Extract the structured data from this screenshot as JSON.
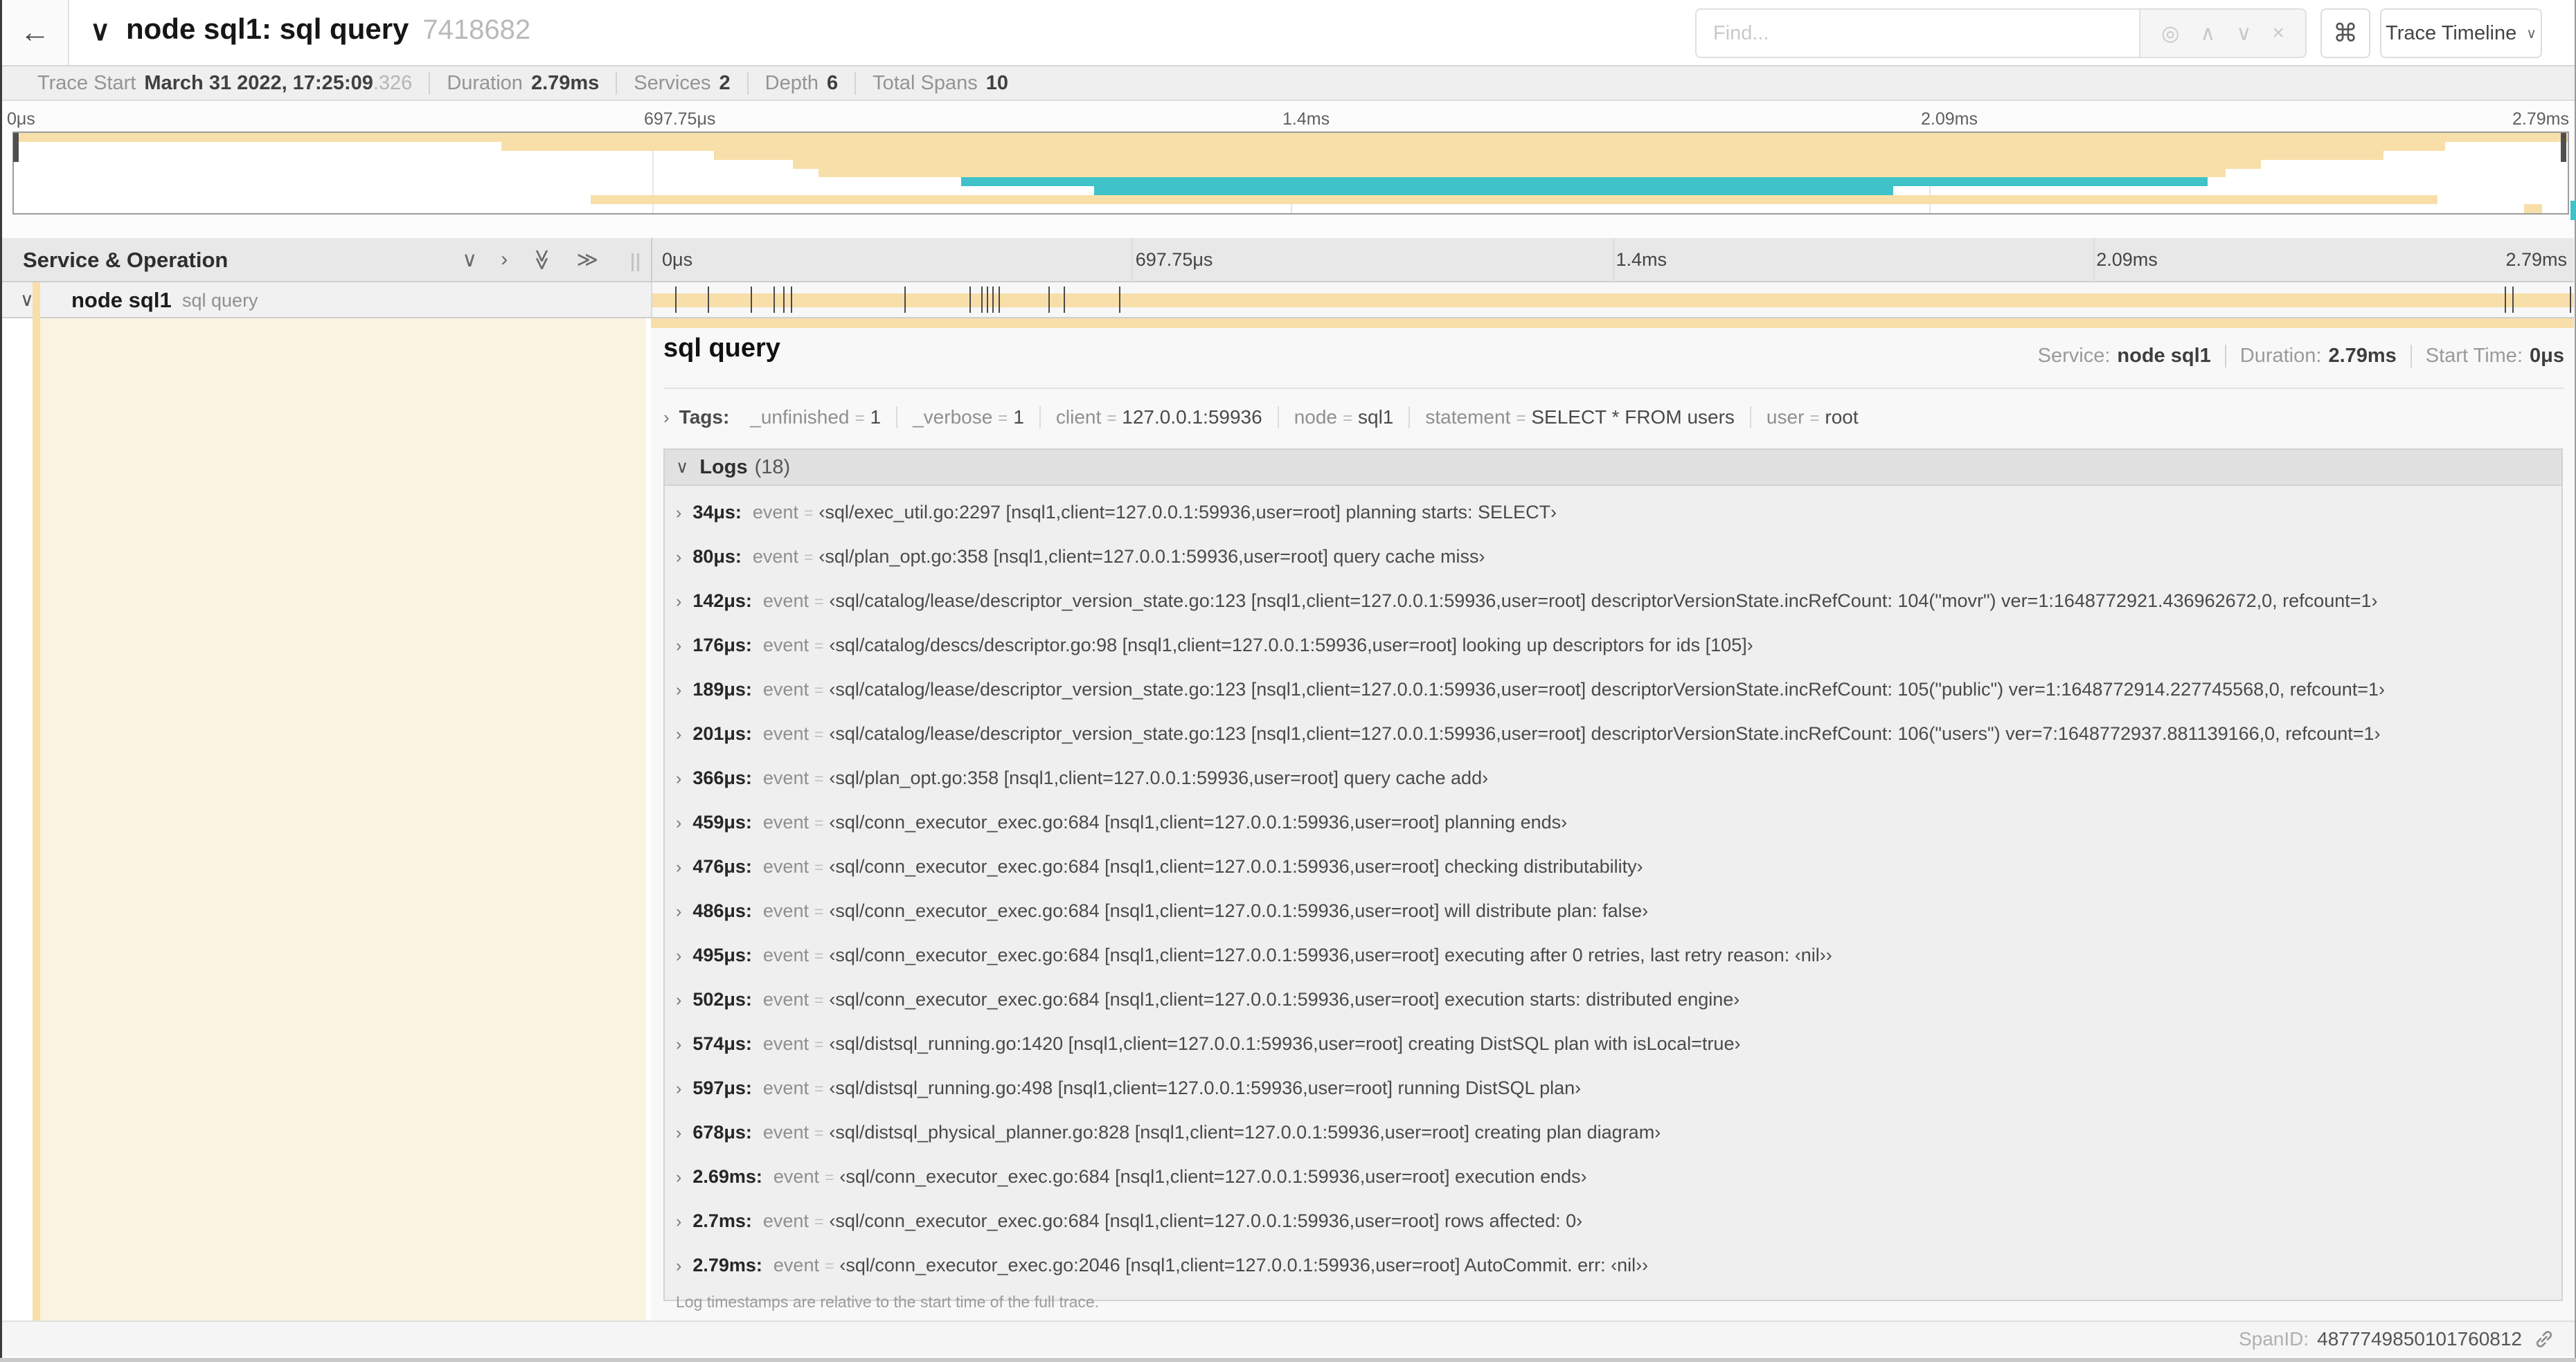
{
  "colors": {
    "span_tan": "#f8dfa9",
    "span_teal": "#3fc3c9",
    "detail_cream": "#faf3e1"
  },
  "icons": {
    "back": "←",
    "title_chevron": "∨",
    "locate": "◎",
    "prev": "∧",
    "next": "∨",
    "close": "×",
    "command": "⌘",
    "dropdown_chevron": "∨",
    "collapse_one": "∨",
    "expand_one": "›",
    "collapse_all": "≫",
    "expand_all": "≫",
    "row_chevron": "∨",
    "logs_chevron": "∨",
    "expander": "›"
  },
  "header": {
    "title": "node sql1: sql query",
    "trace_id": "7418682",
    "find_placeholder": "Find...",
    "view_selector": "Trace Timeline"
  },
  "summary": {
    "items": [
      {
        "label": "Trace Start",
        "value": "March 31 2022, 17:25:09",
        "suffix": ".326"
      },
      {
        "label": "Duration",
        "value": "2.79ms",
        "suffix": ""
      },
      {
        "label": "Services",
        "value": "2",
        "suffix": ""
      },
      {
        "label": "Depth",
        "value": "6",
        "suffix": ""
      },
      {
        "label": "Total Spans",
        "value": "10",
        "suffix": ""
      }
    ]
  },
  "time_ticks": [
    "0μs",
    "697.75μs",
    "1.4ms",
    "2.09ms",
    "2.79ms"
  ],
  "minimap": {
    "rows": 9,
    "spans": [
      {
        "start": 0.0,
        "end": 1.0,
        "color": "span_tan"
      },
      {
        "start": 0.191,
        "end": 0.952,
        "color": "span_tan"
      },
      {
        "start": 0.274,
        "end": 0.928,
        "color": "span_tan"
      },
      {
        "start": 0.305,
        "end": 0.88,
        "color": "span_tan"
      },
      {
        "start": 0.315,
        "end": 0.866,
        "color": "span_tan"
      },
      {
        "start": 0.371,
        "end": 0.859,
        "color": "span_teal"
      },
      {
        "start": 0.423,
        "end": 0.736,
        "color": "span_teal"
      },
      {
        "start": 0.226,
        "end": 0.949,
        "color": "span_tan"
      },
      {
        "start": 0.983,
        "end": 0.99,
        "color": "span_tan"
      }
    ]
  },
  "table": {
    "header_label": "Service & Operation"
  },
  "span_row": {
    "service": "node sql1",
    "operation": "sql query",
    "log_marker_fractions": [
      0.012,
      0.029,
      0.051,
      0.063,
      0.068,
      0.072,
      0.131,
      0.165,
      0.171,
      0.174,
      0.177,
      0.18,
      0.206,
      0.214,
      0.243,
      0.964,
      0.968,
      0.998
    ]
  },
  "detail": {
    "title": "sql query",
    "meta": [
      {
        "label": "Service:",
        "value": "node sql1"
      },
      {
        "label": "Duration:",
        "value": "2.79ms"
      },
      {
        "label": "Start Time:",
        "value": "0μs"
      }
    ],
    "tags_label": "Tags:",
    "eq": "=",
    "tags": [
      {
        "key": "_unfinished",
        "value": "1"
      },
      {
        "key": "_verbose",
        "value": "1"
      },
      {
        "key": "client",
        "value": "127.0.0.1:59936"
      },
      {
        "key": "node",
        "value": "sql1"
      },
      {
        "key": "statement",
        "value": "SELECT * FROM users"
      },
      {
        "key": "user",
        "value": "root"
      }
    ],
    "logs": {
      "label": "Logs",
      "count": "(18)",
      "key": "event",
      "rows": [
        {
          "time": "34μs:",
          "key": "event",
          "value": "‹sql/exec_util.go:2297 [nsql1,client=127.0.0.1:59936,user=root] planning starts: SELECT›"
        },
        {
          "time": "80μs:",
          "key": "event",
          "value": "‹sql/plan_opt.go:358 [nsql1,client=127.0.0.1:59936,user=root] query cache miss›"
        },
        {
          "time": "142μs:",
          "key": "event",
          "value": "‹sql/catalog/lease/descriptor_version_state.go:123 [nsql1,client=127.0.0.1:59936,user=root] descriptorVersionState.incRefCount: 104(\"movr\") ver=1:1648772921.436962672,0, refcount=1›"
        },
        {
          "time": "176μs:",
          "key": "event",
          "value": "‹sql/catalog/descs/descriptor.go:98 [nsql1,client=127.0.0.1:59936,user=root] looking up descriptors for ids [105]›"
        },
        {
          "time": "189μs:",
          "key": "event",
          "value": "‹sql/catalog/lease/descriptor_version_state.go:123 [nsql1,client=127.0.0.1:59936,user=root] descriptorVersionState.incRefCount: 105(\"public\") ver=1:1648772914.227745568,0, refcount=1›"
        },
        {
          "time": "201μs:",
          "key": "event",
          "value": "‹sql/catalog/lease/descriptor_version_state.go:123 [nsql1,client=127.0.0.1:59936,user=root] descriptorVersionState.incRefCount: 106(\"users\") ver=7:1648772937.881139166,0, refcount=1›"
        },
        {
          "time": "366μs:",
          "key": "event",
          "value": "‹sql/plan_opt.go:358 [nsql1,client=127.0.0.1:59936,user=root] query cache add›"
        },
        {
          "time": "459μs:",
          "key": "event",
          "value": "‹sql/conn_executor_exec.go:684 [nsql1,client=127.0.0.1:59936,user=root] planning ends›"
        },
        {
          "time": "476μs:",
          "key": "event",
          "value": "‹sql/conn_executor_exec.go:684 [nsql1,client=127.0.0.1:59936,user=root] checking distributability›"
        },
        {
          "time": "486μs:",
          "key": "event",
          "value": "‹sql/conn_executor_exec.go:684 [nsql1,client=127.0.0.1:59936,user=root] will distribute plan: false›"
        },
        {
          "time": "495μs:",
          "key": "event",
          "value": "‹sql/conn_executor_exec.go:684 [nsql1,client=127.0.0.1:59936,user=root] executing after 0 retries, last retry reason: ‹nil››"
        },
        {
          "time": "502μs:",
          "key": "event",
          "value": "‹sql/conn_executor_exec.go:684 [nsql1,client=127.0.0.1:59936,user=root] execution starts: distributed engine›"
        },
        {
          "time": "574μs:",
          "key": "event",
          "value": "‹sql/distsql_running.go:1420 [nsql1,client=127.0.0.1:59936,user=root] creating DistSQL plan with isLocal=true›"
        },
        {
          "time": "597μs:",
          "key": "event",
          "value": "‹sql/distsql_running.go:498 [nsql1,client=127.0.0.1:59936,user=root] running DistSQL plan›"
        },
        {
          "time": "678μs:",
          "key": "event",
          "value": "‹sql/distsql_physical_planner.go:828 [nsql1,client=127.0.0.1:59936,user=root] creating plan diagram›"
        },
        {
          "time": "2.69ms:",
          "key": "event",
          "value": "‹sql/conn_executor_exec.go:684 [nsql1,client=127.0.0.1:59936,user=root] execution ends›"
        },
        {
          "time": "2.7ms:",
          "key": "event",
          "value": "‹sql/conn_executor_exec.go:684 [nsql1,client=127.0.0.1:59936,user=root] rows affected: 0›"
        },
        {
          "time": "2.79ms:",
          "key": "event",
          "value": "‹sql/conn_executor_exec.go:2046 [nsql1,client=127.0.0.1:59936,user=root] AutoCommit. err: ‹nil››"
        }
      ],
      "footnote": "Log timestamps are relative to the start time of the full trace."
    },
    "footer": {
      "label": "SpanID:",
      "value": "4877749850101760812"
    }
  }
}
